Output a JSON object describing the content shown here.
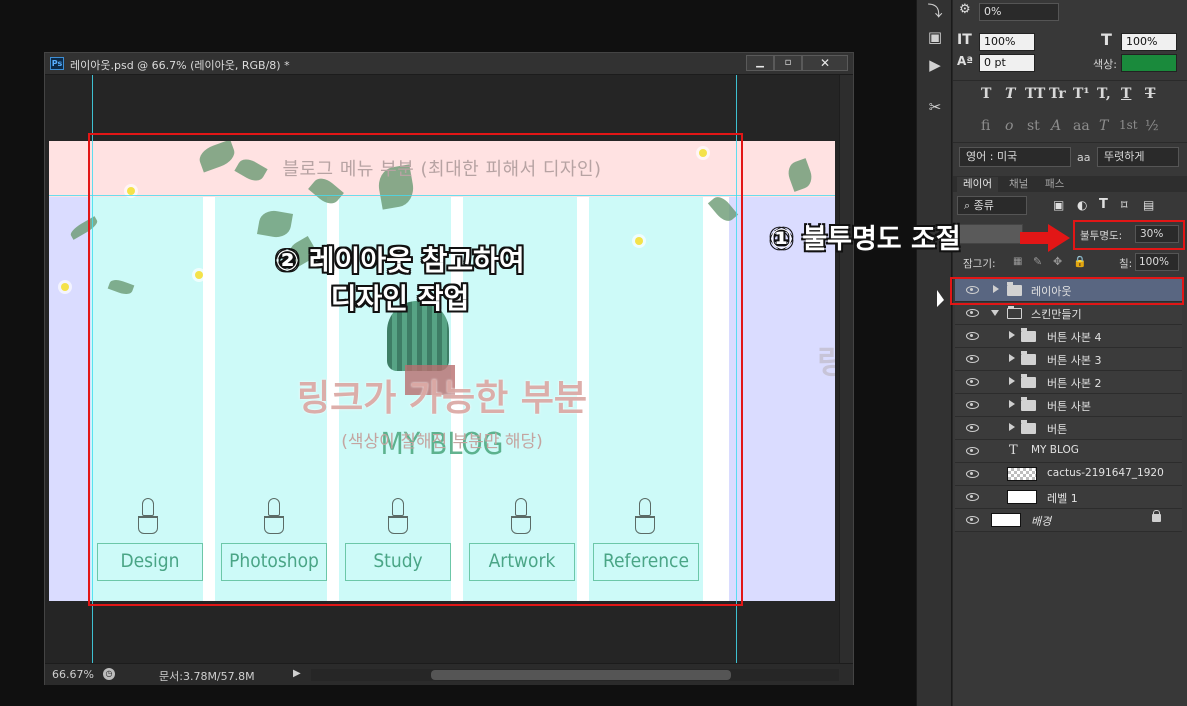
{
  "document": {
    "title": "레이아웃.psd @ 66.7% (레이아웃, RGB/8) *",
    "ps_icon": "Ps",
    "zoom": "66.67%",
    "doc_info": "문서:3.78M/57.8M"
  },
  "artwork": {
    "menu_text": "블로그 메뉴 부분 (최대한 피해서 디자인)",
    "link_text": "링크가 가능한 부분",
    "link_sub": "(색상이 칠해진 부분만 해당)",
    "blog_title": "MY BLOG",
    "right_glyph": "링",
    "nav": [
      "Design",
      "Photoshop",
      "Study",
      "Artwork",
      "Reference"
    ]
  },
  "annotations": {
    "step2_line1": "② 레이아웃 참고하여",
    "step2_line2": "디자인 작업",
    "step1": "① 불투명도 조절"
  },
  "character_panel": {
    "tracking_value": "0%",
    "vert_scale": "100%",
    "horiz_scale": "100%",
    "baseline": "0 pt",
    "color_label": "색상:",
    "color_swatch": "#1a8a3c",
    "language": "영어 : 미국",
    "aa_label": "a",
    "antialias": "뚜렷하게",
    "type_styles": [
      "T",
      "T",
      "TT",
      "Tr",
      "T¹",
      "T,",
      "T",
      "T"
    ],
    "opentype": [
      "fi",
      "o",
      "st",
      "A",
      "aa",
      "T",
      "1st",
      "½"
    ]
  },
  "layers_panel": {
    "tabs": [
      "레이어",
      "채널",
      "패스"
    ],
    "filter": "종류",
    "opacity_label": "불투명도:",
    "opacity_value": "30%",
    "lock_label": "잠그기:",
    "fill_label": "칠:",
    "fill_value": "100%",
    "layers": [
      {
        "name": "레이아웃",
        "type": "group",
        "expanded": false,
        "indent": 0,
        "selected": true
      },
      {
        "name": "스킨만들기",
        "type": "group",
        "expanded": true,
        "indent": 0
      },
      {
        "name": "버튼 사본 4",
        "type": "group",
        "expanded": false,
        "indent": 1
      },
      {
        "name": "버튼 사본 3",
        "type": "group",
        "expanded": false,
        "indent": 1
      },
      {
        "name": "버튼 사본 2",
        "type": "group",
        "expanded": false,
        "indent": 1
      },
      {
        "name": "버튼 사본",
        "type": "group",
        "expanded": false,
        "indent": 1
      },
      {
        "name": "버튼",
        "type": "group",
        "expanded": false,
        "indent": 1
      },
      {
        "name": "MY BLOG",
        "type": "text",
        "indent": 1
      },
      {
        "name": "cactus-2191647_1920",
        "type": "image",
        "indent": 1
      },
      {
        "name": "레벨 1",
        "type": "image",
        "indent": 1
      },
      {
        "name": "배경",
        "type": "background",
        "indent": 0,
        "locked": true
      }
    ]
  },
  "colors": {
    "highlight_red": "#e21616",
    "guide_cyan": "#43dcf0",
    "selected_layer": "#596681"
  }
}
